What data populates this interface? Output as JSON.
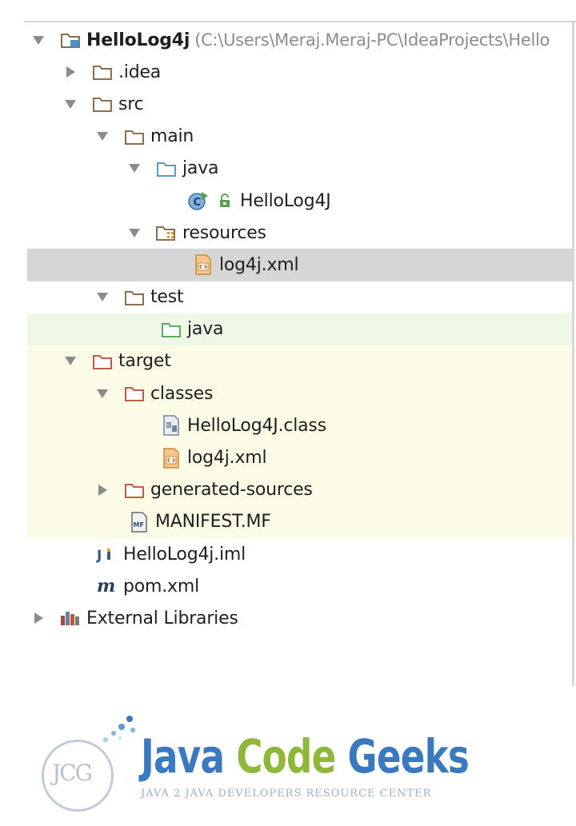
{
  "tree": {
    "root": {
      "label": "HelloLog4j",
      "path": "(C:\\Users\\Meraj.Meraj-PC\\IdeaProjects\\Hello"
    },
    "items": [
      {
        "label": ".idea"
      },
      {
        "label": "src"
      },
      {
        "label": "main"
      },
      {
        "label": "java"
      },
      {
        "label": "HelloLog4J"
      },
      {
        "label": "resources"
      },
      {
        "label": "log4j.xml"
      },
      {
        "label": "test"
      },
      {
        "label": "java"
      },
      {
        "label": "target"
      },
      {
        "label": "classes"
      },
      {
        "label": "HelloLog4J.class"
      },
      {
        "label": "log4j.xml"
      },
      {
        "label": "generated-sources"
      },
      {
        "label": "MANIFEST.MF"
      },
      {
        "label": "HelloLog4j.iml"
      },
      {
        "label": "pom.xml"
      },
      {
        "label": "External Libraries"
      }
    ]
  },
  "colors": {
    "selected_row": "#d6d6d6",
    "test_source_row": "#eff8e6",
    "excluded_row": "#fbfbe6",
    "folder_stroke": "#8a6f52",
    "source_folder": "#5a9cc7",
    "test_folder": "#5dab5d",
    "excluded_folder": "#b8604c"
  },
  "watermark": {
    "title_part1": "Java",
    "title_part2": "Code",
    "title_part3": "Geeks",
    "subtitle": "JAVA 2 JAVA DEVELOPERS RESOURCE CENTER",
    "logo": "JCG"
  }
}
